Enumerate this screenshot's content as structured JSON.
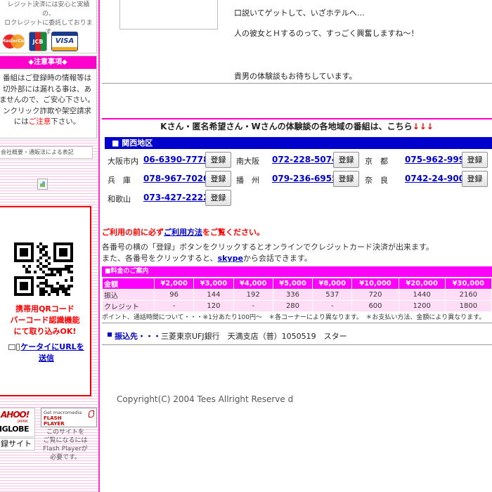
{
  "sidebar": {
    "payment_note_line1": "レジット決済には安心と実績の、",
    "payment_note_line2": "ロクレジットに委託しております",
    "cards": {
      "mastercard": "MasterCard",
      "jcb": "JCB",
      "visa": "VISA"
    },
    "notice_header": "◆注意事項◆",
    "notice_lines": [
      "番組はご登録時の情報等は",
      "切外部には漏れる事は、あ",
      "ませんので、ご安心下さい。",
      "ンクリック詐欺や架空請求"
    ],
    "notice_last_prefix": "には",
    "notice_last_highlight": "ご注意",
    "notice_last_suffix": "下さい。",
    "legal_link": "会社概要・通販法による表記",
    "qr_lines": [
      "携帯用QRコード",
      "バーコード認識機能",
      "にて取り込みOK!"
    ],
    "mail_link_text": "ケータイにURLを",
    "mail_link_text2": "送信",
    "yahoo_logo": "AHOO!",
    "yahoo_sub": "JAPAN",
    "iglobe": "IGLOBE",
    "register": "録サイト",
    "flash_line1": "Get macromedia",
    "flash_line2": "FLASH",
    "flash_line3": "PLAYER",
    "flash_note": [
      "このサイトを",
      "ご覧になるには",
      "Flash Playerが",
      "必要です。"
    ]
  },
  "story": {
    "line1": "口説いてゲットして、いざホテルへ…",
    "line2": "人の彼女とＨするのって、すっごく興奮しますね～！",
    "line3": "貴男の体験談もお待ちしています。"
  },
  "regions": {
    "title": "Kさん・匿名希望さん・Wさんの体験談の各地域の番組は、こちら",
    "arrows": "↓↓↓",
    "bar_label": "■ 関西地区",
    "button_label": "登録",
    "rows": [
      [
        {
          "area": "大阪市内",
          "number": "06-6390-7778"
        },
        {
          "area": "南大阪",
          "number": "072-228-5074"
        },
        {
          "area": "京　都",
          "number": "075-962-9999"
        }
      ],
      [
        {
          "area": "兵　庫",
          "number": "078-967-7020"
        },
        {
          "area": "播　州",
          "number": "079-236-6955"
        },
        {
          "area": "奈　良",
          "number": "0742-24-9000"
        }
      ],
      [
        {
          "area": "和歌山",
          "number": "073-427-2222"
        }
      ]
    ]
  },
  "notices": {
    "line1_prefix": "ご利用の前に必ず",
    "line1_link": "ご利用方法",
    "line1_suffix": "をご覧ください。",
    "line2": "各番号の横の「登録」ボタンをクリックするとオンラインでクレジットカード決済が出来ます。",
    "line3_prefix": "また、各番号をクリックすると、",
    "line3_link": "skype",
    "line3_suffix": "から会話できます。"
  },
  "pricing": {
    "bar_label": "■料金のご案内",
    "header": [
      "金額",
      "¥2,000",
      "¥3,000",
      "¥4,000",
      "¥5,000",
      "¥8,000",
      "¥10,000",
      "¥20,000",
      "¥30,000"
    ],
    "rows": [
      [
        "振込",
        "96",
        "144",
        "192",
        "336",
        "537",
        "720",
        "1440",
        "2160"
      ],
      [
        "クレジット",
        "-",
        "120",
        "-",
        "280",
        "-",
        "600",
        "1200",
        "1800"
      ]
    ],
    "note": "ポイント、通話時間について・・・※1分あたり100円～　＊各コーナーにより異なります。　＊お支払い方法、金額により異なります。"
  },
  "bank": {
    "label": "振込先・・・",
    "detail": "三菱東京UFJ銀行　天満支店（普）1050519　スター"
  },
  "footer": {
    "copyright": "Copyright(C) 2004 Tees Allright Reserve d"
  },
  "colors": {
    "magenta": "#ff00ff",
    "pink_accent": "#ff00cc",
    "link_blue": "#0000cc",
    "alert_red": "#ff0000"
  }
}
